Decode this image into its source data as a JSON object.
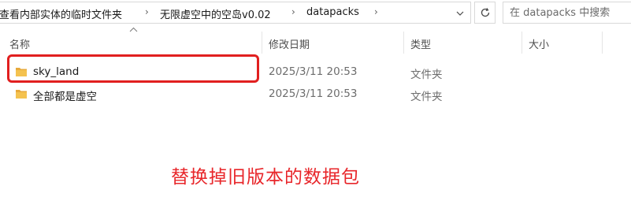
{
  "address_bar": {
    "breadcrumbs": [
      "查看内部实体的临时文件夹",
      "无限虚空中的空岛v0.02",
      "datapacks"
    ],
    "search_placeholder": "在 datapacks 中搜索"
  },
  "columns": [
    "名称",
    "修改日期",
    "类型",
    "大小"
  ],
  "files": [
    {
      "name": "sky_land",
      "date": "2025/3/11 20:53",
      "type": "文件夹",
      "size": ""
    },
    {
      "name": "全部都是虚空",
      "date": "2025/3/11 20:53",
      "type": "文件夹",
      "size": ""
    }
  ],
  "annotation": "替换掉旧版本的数据包",
  "colors": {
    "annotation": "#e8262a",
    "highlight_border": "#e11f1f",
    "folder": "#f4c24f"
  },
  "icons": [
    "breadcrumb-chevron-icon",
    "dropdown-chevron-icon",
    "refresh-icon",
    "sort-ascending-icon",
    "folder-icon"
  ]
}
